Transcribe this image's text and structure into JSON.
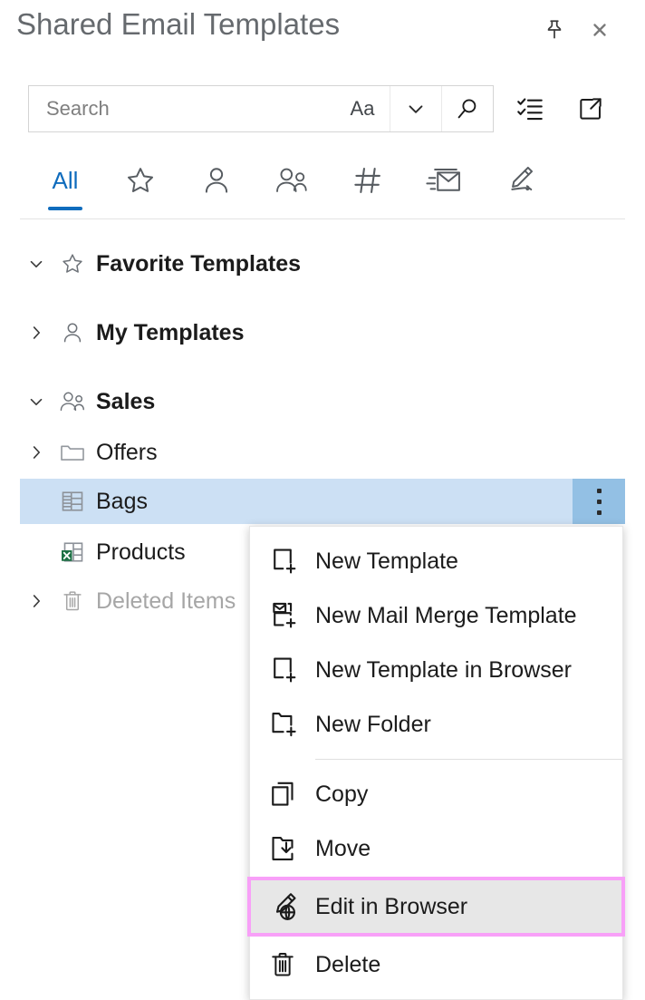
{
  "window": {
    "title": "Shared Email Templates",
    "pin_tooltip": "Pin",
    "close_tooltip": "Close"
  },
  "search": {
    "placeholder": "Search",
    "value": "",
    "match_case_label": "Aa",
    "dropdown_icon": "chevron-down-icon",
    "search_icon": "magnifier-icon"
  },
  "toolbar": {
    "buttons": [
      {
        "name": "checklist-button",
        "icon": "checklist-icon"
      },
      {
        "name": "popout-button",
        "icon": "open-in-new-window-icon"
      }
    ]
  },
  "tabs": [
    {
      "id": "all",
      "label": "All",
      "icon": null,
      "active": true
    },
    {
      "id": "favorites",
      "label": "",
      "icon": "star-icon",
      "active": false
    },
    {
      "id": "my-templates",
      "label": "",
      "icon": "person-icon",
      "active": false
    },
    {
      "id": "team-templates",
      "label": "",
      "icon": "people-icon",
      "active": false
    },
    {
      "id": "hashtags",
      "label": "",
      "icon": "hash-icon",
      "active": false
    },
    {
      "id": "mail-merge",
      "label": "",
      "icon": "mail-send-icon",
      "active": false
    },
    {
      "id": "signatures",
      "label": "",
      "icon": "signature-pen-icon",
      "active": false
    }
  ],
  "tree": [
    {
      "id": "favorite-templates",
      "label": "Favorite Templates",
      "icon": "star-icon",
      "chevron": "expanded",
      "bold": true,
      "dim": false,
      "selected": false,
      "indent": 0
    },
    {
      "id": "my-templates",
      "label": "My Templates",
      "icon": "person-icon",
      "chevron": "collapsed",
      "bold": true,
      "dim": false,
      "selected": false,
      "indent": 0
    },
    {
      "id": "sales",
      "label": "Sales",
      "icon": "people-icon",
      "chevron": "expanded",
      "bold": true,
      "dim": false,
      "selected": false,
      "indent": 0
    },
    {
      "id": "offers",
      "label": "Offers",
      "icon": "folder-icon",
      "chevron": "collapsed",
      "bold": false,
      "dim": false,
      "selected": false,
      "indent": 0
    },
    {
      "id": "bags",
      "label": "Bags",
      "icon": "table-icon",
      "chevron": "none",
      "bold": false,
      "dim": false,
      "selected": true,
      "indent": 0
    },
    {
      "id": "products",
      "label": "Products",
      "icon": "excel-table-icon",
      "chevron": "none",
      "bold": false,
      "dim": false,
      "selected": false,
      "indent": 0
    },
    {
      "id": "deleted-items",
      "label": "Deleted Items",
      "icon": "trash-icon",
      "chevron": "collapsed",
      "bold": false,
      "dim": true,
      "selected": false,
      "indent": 0
    }
  ],
  "context_menu": {
    "items": [
      {
        "id": "new-template",
        "label": "New Template",
        "icon": "new-document-icon",
        "separator_after": false,
        "highlighted": false
      },
      {
        "id": "new-mail-merge-template",
        "label": "New Mail Merge Template",
        "icon": "new-mail-merge-icon",
        "separator_after": false,
        "highlighted": false
      },
      {
        "id": "new-template-in-browser",
        "label": "New Template in Browser",
        "icon": "new-document-icon",
        "separator_after": false,
        "highlighted": false
      },
      {
        "id": "new-folder",
        "label": "New Folder",
        "icon": "new-folder-icon",
        "separator_after": true,
        "highlighted": false
      },
      {
        "id": "copy",
        "label": "Copy",
        "icon": "copy-icon",
        "separator_after": false,
        "highlighted": false
      },
      {
        "id": "move",
        "label": "Move",
        "icon": "move-icon",
        "separator_after": false,
        "highlighted": false
      },
      {
        "id": "edit-in-browser",
        "label": "Edit in Browser",
        "icon": "edit-in-browser-icon",
        "separator_after": false,
        "highlighted": true
      },
      {
        "id": "delete",
        "label": "Delete",
        "icon": "trash-icon",
        "separator_after": false,
        "highlighted": false
      }
    ]
  },
  "colors": {
    "accent": "#0f6cbd",
    "selection_bg": "#cce0f4",
    "selection_btn_bg": "#93c0e4",
    "highlight_outline": "#f8a0f8",
    "menu_highlight_bg": "#e7e7e7",
    "title_text": "#666a6e",
    "dim_text": "#a6a6a6",
    "excel_green": "#1d7044"
  }
}
